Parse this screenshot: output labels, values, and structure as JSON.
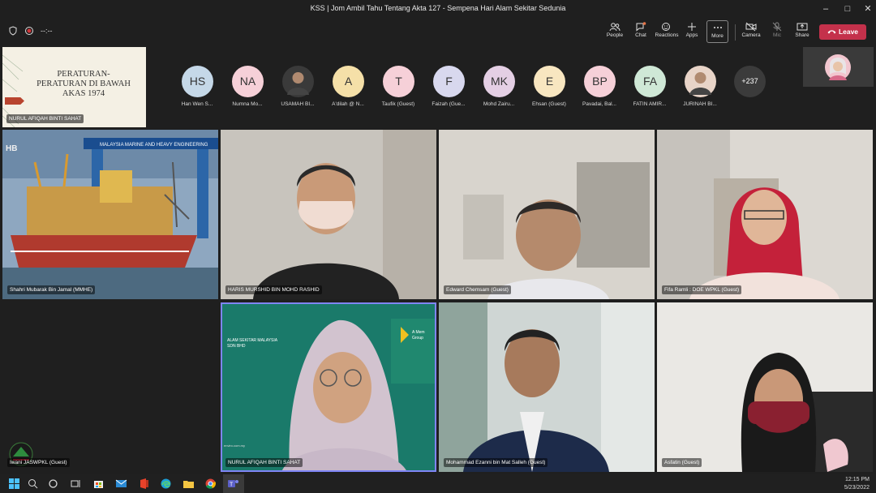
{
  "window": {
    "title": "KSS | Jom Ambil Tahu Tentang Akta 127 - Sempena Hari Alam Sekitar Sedunia"
  },
  "meeting": {
    "timer": "--:--",
    "toolbar": {
      "people": "People",
      "chat": "Chat",
      "reactions": "Reactions",
      "apps": "Apps",
      "more": "More",
      "camera": "Camera",
      "mic": "Mic",
      "share": "Share",
      "leave": "Leave"
    }
  },
  "presenter": {
    "slide_text": "PERATURAN-\nPERATURAN DI BAWAH\nAKAS 1974",
    "name": "NURUL AFIQAH BINTI SAHAT"
  },
  "attendees": [
    {
      "initials": "HS",
      "name": "Han Wen S...",
      "color": "#c5d8e8"
    },
    {
      "initials": "NA",
      "name": "Numna Mo...",
      "color": "#f6d0d8"
    },
    {
      "initials": "",
      "name": "USAMAH BI...",
      "color": "#3a3a3a"
    },
    {
      "initials": "A",
      "name": "A'dilah @ N...",
      "color": "#f5e0a8"
    },
    {
      "initials": "T",
      "name": "Taufik (Guest)",
      "color": "#f6d0d8"
    },
    {
      "initials": "F",
      "name": "Faizah (Gue...",
      "color": "#d8d8ee"
    },
    {
      "initials": "MK",
      "name": "Mohd Zairu...",
      "color": "#e4cfe4"
    },
    {
      "initials": "E",
      "name": "Ehsan (Guest)",
      "color": "#f8e6c0"
    },
    {
      "initials": "BP",
      "name": "Pavadai, Bal...",
      "color": "#f6d0d8"
    },
    {
      "initials": "FA",
      "name": "FATIN AMIR...",
      "color": "#cfe8d6"
    },
    {
      "initials": "",
      "name": "JURINAH BI...",
      "color": "#e8d4c8"
    }
  ],
  "more_participants": "+237",
  "tiles": [
    {
      "name": "Shahri Mubarak Bin Jamal (MMHE)"
    },
    {
      "name": "HARIS MURSHID BIN MOHD RASHID"
    },
    {
      "name": "Edward  Chemsam (Guest)"
    },
    {
      "name": "Fifa Ramli : DOE WPKL (Guest)"
    },
    {
      "name": "Iwani JASWPKL (Guest)"
    },
    {
      "name": "NURUL AFIQAH BINTI SAHAT"
    },
    {
      "name": "Mohammad Ezanni bin Mat Salleh (Guest)"
    },
    {
      "name": "Asfatin (Guest)"
    }
  ],
  "tile_text": {
    "ship_banner": "MALAYSIA MARINE AND HEAVY ENGINEERING",
    "hb": "HB",
    "alam": "ALAM SEKITAR MALAYSIA\nSDN BHD",
    "group": "A Mem\nGroup",
    "web": "enviro.com.my"
  },
  "clock": {
    "time": "12:15 PM",
    "date": "5/23/2022"
  }
}
